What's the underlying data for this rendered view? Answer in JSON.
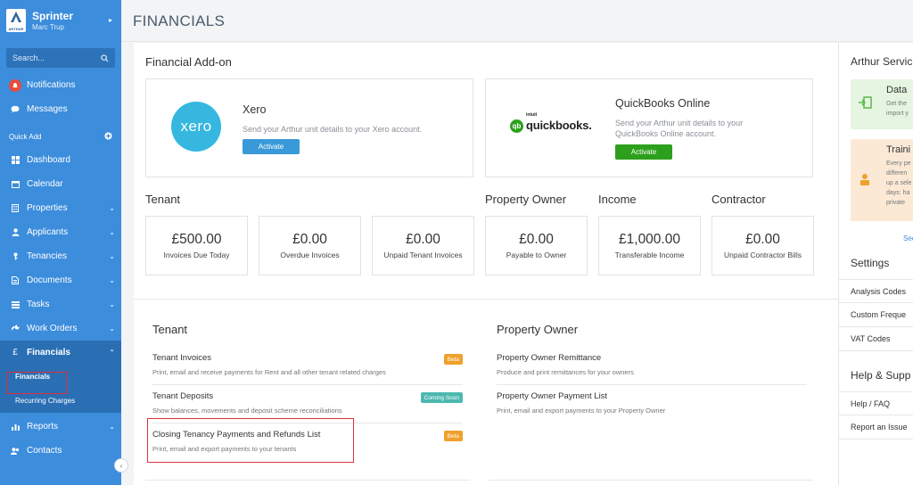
{
  "sidebar": {
    "brand": {
      "name": "Sprinter",
      "user": "Marc Trup",
      "logo_text": "ARTHUR"
    },
    "search_placeholder": "Search...",
    "notifications": "Notifications",
    "messages": "Messages",
    "quick_add": "Quick Add",
    "items": [
      {
        "label": "Dashboard",
        "icon": "dashboard-icon"
      },
      {
        "label": "Calendar",
        "icon": "calendar-icon"
      },
      {
        "label": "Properties",
        "icon": "building-icon"
      },
      {
        "label": "Applicants",
        "icon": "user-icon"
      },
      {
        "label": "Tenancies",
        "icon": "key-icon"
      },
      {
        "label": "Documents",
        "icon": "document-icon"
      },
      {
        "label": "Tasks",
        "icon": "tasks-icon"
      },
      {
        "label": "Work Orders",
        "icon": "wrench-icon"
      },
      {
        "label": "Financials",
        "icon": "pound-icon"
      },
      {
        "label": "Reports",
        "icon": "chart-icon"
      },
      {
        "label": "Contacts",
        "icon": "contacts-icon"
      }
    ],
    "financials_sub": [
      "Financials",
      "Recurring Charges"
    ]
  },
  "header": {
    "title": "FINANCIALS"
  },
  "addons": {
    "title": "Financial Add-on",
    "xero": {
      "logo": "xero",
      "name": "Xero",
      "desc": "Send your Arthur unit details to your Xero account.",
      "button": "Activate",
      "button_color": "#3a9ad9"
    },
    "quickbooks": {
      "logo_intuit": "intuit",
      "logo_text": "quickbooks.",
      "logo_badge": "qb",
      "name": "QuickBooks Online",
      "desc_line1": "Send your Arthur unit details to your",
      "desc_line2": "QuickBooks Online account.",
      "button": "Activate",
      "button_color": "#2ca01c"
    }
  },
  "stats": {
    "tenant_title": "Tenant",
    "owner_title": "Property Owner",
    "income_title": "Income",
    "contractor_title": "Contractor",
    "cards": [
      {
        "value": "£500.00",
        "label": "Invoices Due Today"
      },
      {
        "value": "£0.00",
        "label": "Overdue Invoices"
      },
      {
        "value": "£0.00",
        "label": "Unpaid Tenant Invoices"
      },
      {
        "value": "£0.00",
        "label": "Payable to Owner"
      },
      {
        "value": "£1,000.00",
        "label": "Transferable Income"
      },
      {
        "value": "£0.00",
        "label": "Unpaid Contractor Bills"
      }
    ]
  },
  "tenant_links": {
    "title": "Tenant",
    "items": [
      {
        "title": "Tenant Invoices",
        "sub": "Print, email and receive payments for Rent and all other tenant related charges",
        "badge": "Beta",
        "badge_color": "#f0a02c"
      },
      {
        "title": "Tenant Deposits",
        "sub": "Show balances, movements and deposit scheme reconciliations",
        "badge": "Coming Soon",
        "badge_color": "#4cb8b0"
      },
      {
        "title": "Closing Tenancy Payments and Refunds List",
        "sub": "Print, email and export payments to your tenants",
        "badge": "Beta",
        "badge_color": "#f0a02c"
      }
    ]
  },
  "owner_links": {
    "title": "Property Owner",
    "items": [
      {
        "title": "Property Owner Remittance",
        "sub": "Produce and print remittances for your owners"
      },
      {
        "title": "Property Owner Payment List",
        "sub": "Print, email and export payments to your Property Owner"
      }
    ]
  },
  "right": {
    "services_title": "Arthur Servic",
    "data_card": {
      "title": "Data",
      "line1": "Get the",
      "line2": "import y"
    },
    "training_card": {
      "title": "Traini",
      "line1": "Every pe",
      "line2": "differen",
      "line3": "up a sele",
      "line4": "days: ha",
      "line5": "private"
    },
    "see_link": "See",
    "settings_title": "Settings",
    "settings_items": [
      "Analysis Codes",
      "Custom Freque",
      "VAT Codes"
    ],
    "help_title": "Help & Supp",
    "help_items": [
      "Help / FAQ",
      "Report an Issue"
    ]
  }
}
